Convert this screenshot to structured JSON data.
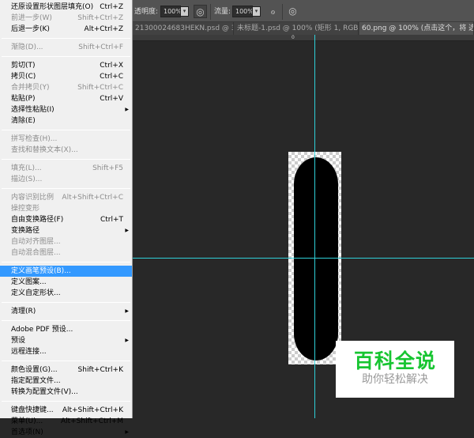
{
  "toolbar": {
    "opacity_label": "透明度:",
    "opacity_value": "100%",
    "flow_label": "流量:",
    "flow_value": "100%"
  },
  "tabs": [
    {
      "label": "21300024683HEKN.psd @ 3...",
      "close": "×"
    },
    {
      "label": "未标题-1.psd @ 100% (矩形 1, RGB/...",
      "close": "×"
    },
    {
      "label": "60.png @ 100% (点击这个，将 选区转"
    }
  ],
  "ruler": {
    "zero": "0"
  },
  "watermark": {
    "title": "百科全说",
    "subtitle": "助你轻松解决",
    "title_color": "#17c531"
  },
  "guide_color": "#2fd0d8",
  "menu": {
    "groups": [
      [
        {
          "label": "还原设置形状图层填充(O)",
          "shortcut": "Ctrl+Z"
        },
        {
          "label": "前进一步(W)",
          "shortcut": "Shift+Ctrl+Z",
          "disabled": true
        },
        {
          "label": "后退一步(K)",
          "shortcut": "Alt+Ctrl+Z"
        }
      ],
      [
        {
          "label": "渐隐(D)...",
          "shortcut": "Shift+Ctrl+F",
          "disabled": true
        }
      ],
      [
        {
          "label": "剪切(T)",
          "shortcut": "Ctrl+X"
        },
        {
          "label": "拷贝(C)",
          "shortcut": "Ctrl+C"
        },
        {
          "label": "合并拷贝(Y)",
          "shortcut": "Shift+Ctrl+C",
          "disabled": true
        },
        {
          "label": "粘贴(P)",
          "shortcut": "Ctrl+V"
        },
        {
          "label": "选择性粘贴(I)",
          "submenu": true
        },
        {
          "label": "清除(E)"
        }
      ],
      [
        {
          "label": "拼写检查(H)...",
          "disabled": true
        },
        {
          "label": "查找和替换文本(X)...",
          "disabled": true
        }
      ],
      [
        {
          "label": "填充(L)...",
          "shortcut": "Shift+F5",
          "disabled": true
        },
        {
          "label": "描边(S)...",
          "disabled": true
        }
      ],
      [
        {
          "label": "内容识别比例",
          "shortcut": "Alt+Shift+Ctrl+C",
          "disabled": true
        },
        {
          "label": "操控变形",
          "disabled": true
        },
        {
          "label": "自由变换路径(F)",
          "shortcut": "Ctrl+T"
        },
        {
          "label": "变换路径",
          "submenu": true
        },
        {
          "label": "自动对齐图层...",
          "disabled": true
        },
        {
          "label": "自动混合图层...",
          "disabled": true
        }
      ],
      [
        {
          "label": "定义画笔预设(B)...",
          "highlighted": true
        },
        {
          "label": "定义图案..."
        },
        {
          "label": "定义自定形状..."
        }
      ],
      [
        {
          "label": "清理(R)",
          "submenu": true
        }
      ],
      [
        {
          "label": "Adobe PDF 预设..."
        },
        {
          "label": "预设",
          "submenu": true
        },
        {
          "label": "远程连接..."
        }
      ],
      [
        {
          "label": "颜色设置(G)...",
          "shortcut": "Shift+Ctrl+K"
        },
        {
          "label": "指定配置文件..."
        },
        {
          "label": "转换为配置文件(V)..."
        }
      ],
      [
        {
          "label": "键盘快捷键...",
          "shortcut": "Alt+Shift+Ctrl+K"
        },
        {
          "label": "菜单(U)...",
          "shortcut": "Alt+Shift+Ctrl+M"
        },
        {
          "label": "首选项(N)",
          "submenu": true
        }
      ]
    ]
  }
}
